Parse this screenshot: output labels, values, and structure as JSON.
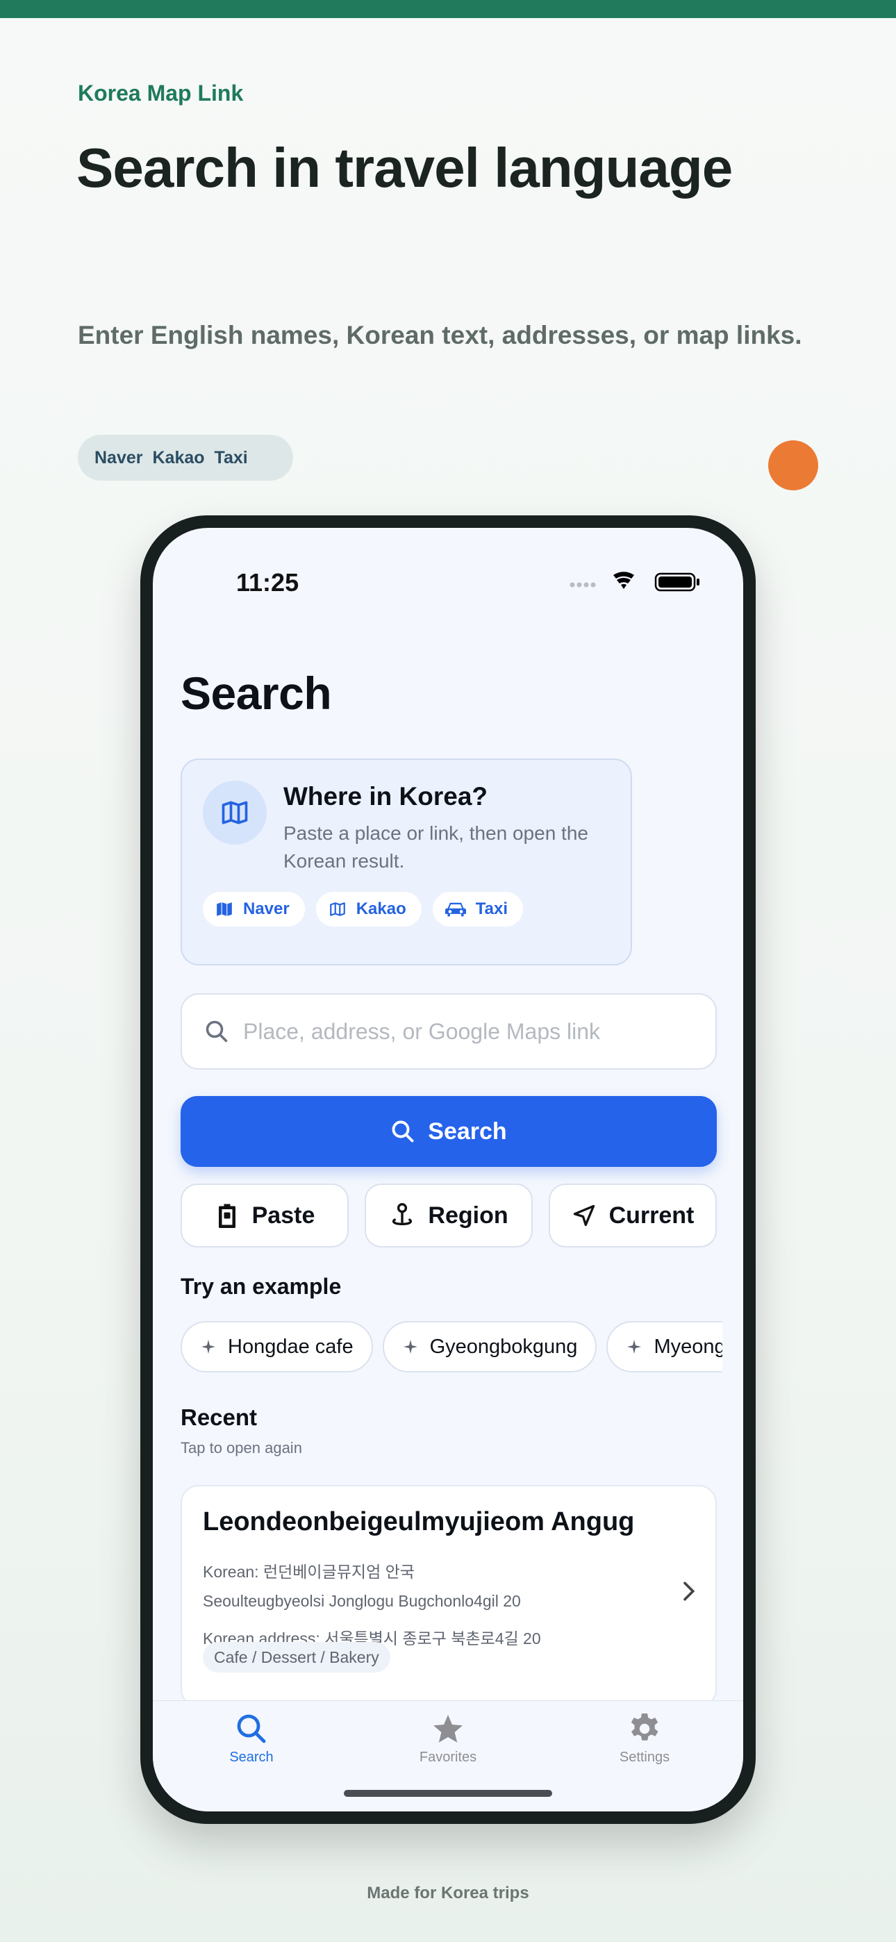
{
  "promo": {
    "eyebrow": "Korea Map Link",
    "headline": "Search in travel language",
    "subline": "Enter English names, Korean text, addresses, or map links.",
    "pill_items": [
      "Naver",
      "Kakao",
      "Taxi"
    ],
    "footer": "Made for Korea trips"
  },
  "colors": {
    "brand_green": "#217a5c",
    "accent_orange": "#eb7a35",
    "primary_blue": "#2563eb"
  },
  "status_bar": {
    "time": "11:25"
  },
  "screen": {
    "title": "Search",
    "hint_card": {
      "icon": "map-icon",
      "title": "Where in Korea?",
      "description": "Paste a place or link, then open the Korean result.",
      "chips": [
        {
          "label": "Naver",
          "icon": "map-filled-icon"
        },
        {
          "label": "Kakao",
          "icon": "map-outline-icon"
        },
        {
          "label": "Taxi",
          "icon": "car-icon"
        }
      ]
    },
    "search": {
      "placeholder": "Place, address, or Google Maps link",
      "value": "",
      "button_label": "Search"
    },
    "actions": [
      {
        "label": "Paste",
        "icon": "clipboard-icon"
      },
      {
        "label": "Region",
        "icon": "pin-icon"
      },
      {
        "label": "Current",
        "icon": "location-arrow-icon"
      }
    ],
    "examples": {
      "title": "Try an example",
      "items": [
        "Hongdae cafe",
        "Gyeongbokgung",
        "Myeongdong"
      ]
    },
    "recent": {
      "title": "Recent",
      "subtitle": "Tap to open again",
      "items": [
        {
          "name": "Leondeonbeigeulmyujieom Angug",
          "korean": "Korean: 런던베이글뮤지엄 안국",
          "romanized_address": "Seoulteugbyeolsi Jonglogu Bugchonlo4gil 20",
          "korean_address": "Korean address: 서울특별시 종로구 북촌로4길 20",
          "category": "Cafe / Dessert / Bakery"
        }
      ]
    },
    "tabbar": [
      {
        "label": "Search",
        "icon": "search-icon",
        "active": true
      },
      {
        "label": "Favorites",
        "icon": "star-icon",
        "active": false
      },
      {
        "label": "Settings",
        "icon": "gear-icon",
        "active": false
      }
    ]
  }
}
